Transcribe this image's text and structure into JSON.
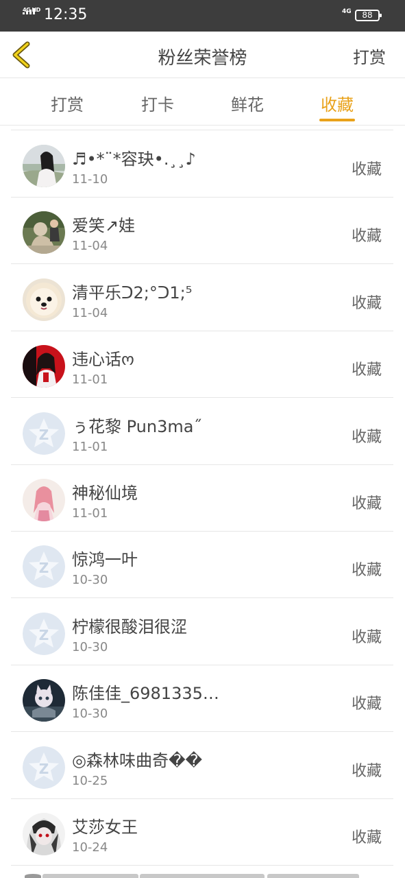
{
  "status_bar": {
    "network": "4G HD",
    "time": "12:35",
    "network2": "4G",
    "battery": "88"
  },
  "header": {
    "title": "粉丝荣誉榜",
    "action": "打赏",
    "back_icon": "chevron-left-icon"
  },
  "tabs": [
    {
      "label": "打赏",
      "active": false
    },
    {
      "label": "打卡",
      "active": false
    },
    {
      "label": "鲜花",
      "active": false
    },
    {
      "label": "收藏",
      "active": true
    }
  ],
  "colors": {
    "accent": "#e9a21a",
    "status_bar": "#3d3d3d",
    "text": "#444444",
    "muted": "#888888"
  },
  "fans": [
    {
      "name": "♬•*¨*容玦•.¸¸♪",
      "date": "11-10",
      "action": "收藏",
      "avatar": "photo-girl-icon"
    },
    {
      "name": "爱笑↗娃",
      "date": "11-04",
      "action": "收藏",
      "avatar": "photo-statue-icon"
    },
    {
      "name": "清平乐ᑐ2;°ᑐ1;⁵",
      "date": "11-04",
      "action": "收藏",
      "avatar": "photo-dog-icon"
    },
    {
      "name": "违心话ო",
      "date": "11-01",
      "action": "收藏",
      "avatar": "photo-anime-red-icon"
    },
    {
      "name": "ぅ花黎 Pun3ma˝",
      "date": "11-01",
      "action": "收藏",
      "avatar": "default-avatar-icon"
    },
    {
      "name": "神秘仙境",
      "date": "11-01",
      "action": "收藏",
      "avatar": "photo-anime-pink-icon"
    },
    {
      "name": "惊鸿一叶",
      "date": "10-30",
      "action": "收藏",
      "avatar": "default-avatar-icon"
    },
    {
      "name": "柠檬很酸泪很涩",
      "date": "10-30",
      "action": "收藏",
      "avatar": "default-avatar-icon"
    },
    {
      "name": "陈佳佳_6981335…",
      "date": "10-30",
      "action": "收藏",
      "avatar": "photo-cat-icon"
    },
    {
      "name": "◎森林味曲奇��",
      "date": "10-25",
      "action": "收藏",
      "avatar": "default-avatar-icon"
    },
    {
      "name": "艾莎女王",
      "date": "10-24",
      "action": "收藏",
      "avatar": "photo-anime-dark-icon"
    }
  ]
}
